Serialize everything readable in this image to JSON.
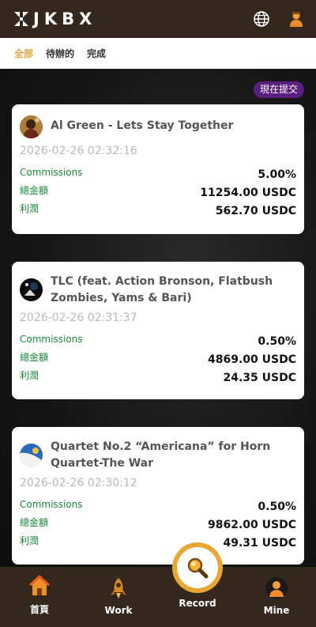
{
  "header": {
    "logo_text": "JKBX",
    "globe_icon": "globe-icon",
    "user_icon": "user-icon"
  },
  "tabs": [
    {
      "label": "全部",
      "active": true
    },
    {
      "label": "待辦的",
      "active": false
    },
    {
      "label": "完成",
      "active": false
    }
  ],
  "submit_button": "現在提交",
  "cards": [
    {
      "title": "Al Green - Lets Stay Together",
      "timestamp": "2026-02-26 02:32:16",
      "labels": [
        "Commissions",
        "總金額",
        "利潤"
      ],
      "values": [
        "5.00%",
        "11254.00 USDC",
        "562.70 USDC"
      ]
    },
    {
      "title": "TLC (feat. Action Bronson, Flatbush Zombies, Yams & Bari)",
      "timestamp": "2026-02-26 02:31:37",
      "labels": [
        "Commissions",
        "總金額",
        "利潤"
      ],
      "values": [
        "0.50%",
        "4869.00 USDC",
        "24.35 USDC"
      ]
    },
    {
      "title": "Quartet No.2 “Americana” for Horn Quartet-The War",
      "timestamp": "2026-02-26 02:30:12",
      "labels": [
        "Commissions",
        "總金額",
        "利潤"
      ],
      "values": [
        "0.50%",
        "9862.00 USDC",
        "49.31 USDC"
      ]
    }
  ],
  "nav": {
    "home": "首頁",
    "work": "Work",
    "record": "Record",
    "mine": "Mine"
  },
  "colors": {
    "header_bg": "#34281d",
    "accent": "#e0a63c",
    "submit_bg": "#5b1f82",
    "label_green": "#1a8a3c"
  }
}
